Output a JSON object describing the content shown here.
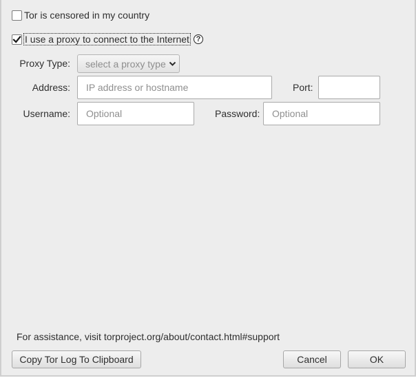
{
  "options": {
    "censored": {
      "label": "Tor is censored in my country",
      "checked": false
    },
    "proxy": {
      "label": "I use a proxy to connect to the Internet",
      "checked": true,
      "help_icon": "question-circle-icon"
    }
  },
  "proxy_settings": {
    "type_label": "Proxy Type:",
    "type_value": "select a proxy type",
    "address_label": "Address:",
    "address_placeholder": "IP address or hostname",
    "address_value": "",
    "port_label": "Port:",
    "port_value": "",
    "username_label": "Username:",
    "username_placeholder": "Optional",
    "username_value": "",
    "password_label": "Password:",
    "password_placeholder": "Optional",
    "password_value": ""
  },
  "footer": {
    "assistance": "For assistance, visit torproject.org/about/contact.html#support",
    "copy_log_label": "Copy Tor Log To Clipboard",
    "cancel_label": "Cancel",
    "ok_label": "OK"
  },
  "colors": {
    "window_bg": "#ededed",
    "field_bg": "#ffffff",
    "placeholder": "#8f8f8f",
    "text": "#2e2e2e"
  }
}
